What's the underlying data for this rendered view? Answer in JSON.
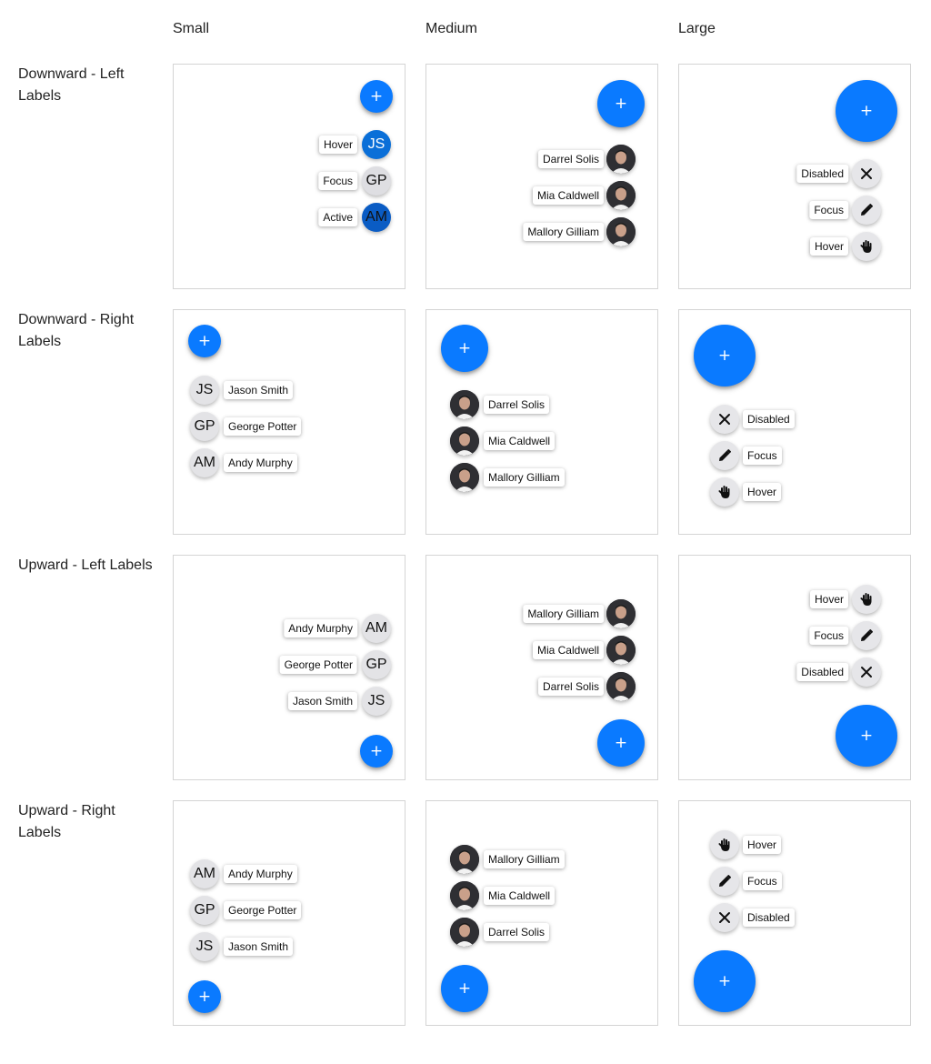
{
  "columns": [
    "Small",
    "Medium",
    "Large"
  ],
  "rows": [
    "Downward - Left Labels",
    "Downward - Right Labels",
    "Upward - Left Labels",
    "Upward - Right Labels"
  ],
  "fab_glyph": "+",
  "people_small": [
    {
      "initials": "JS",
      "name": "Jason Smith"
    },
    {
      "initials": "GP",
      "name": "George Potter"
    },
    {
      "initials": "AM",
      "name": "Andy Murphy"
    }
  ],
  "states_small": [
    "Hover",
    "Focus",
    "Active"
  ],
  "people_medium": [
    "Darrel Solis",
    "Mia Caldwell",
    "Mallory Gilliam"
  ],
  "large_actions": [
    {
      "label": "Disabled",
      "icon": "close-icon"
    },
    {
      "label": "Focus",
      "icon": "pencil-icon"
    },
    {
      "label": "Hover",
      "icon": "hand-icon"
    }
  ],
  "colors": {
    "fab": "#0a7aff",
    "hover": "#0a6fd8",
    "active": "#0a5cc4",
    "action_bg": "#e3e3e6",
    "border": "#d4d4d4"
  }
}
